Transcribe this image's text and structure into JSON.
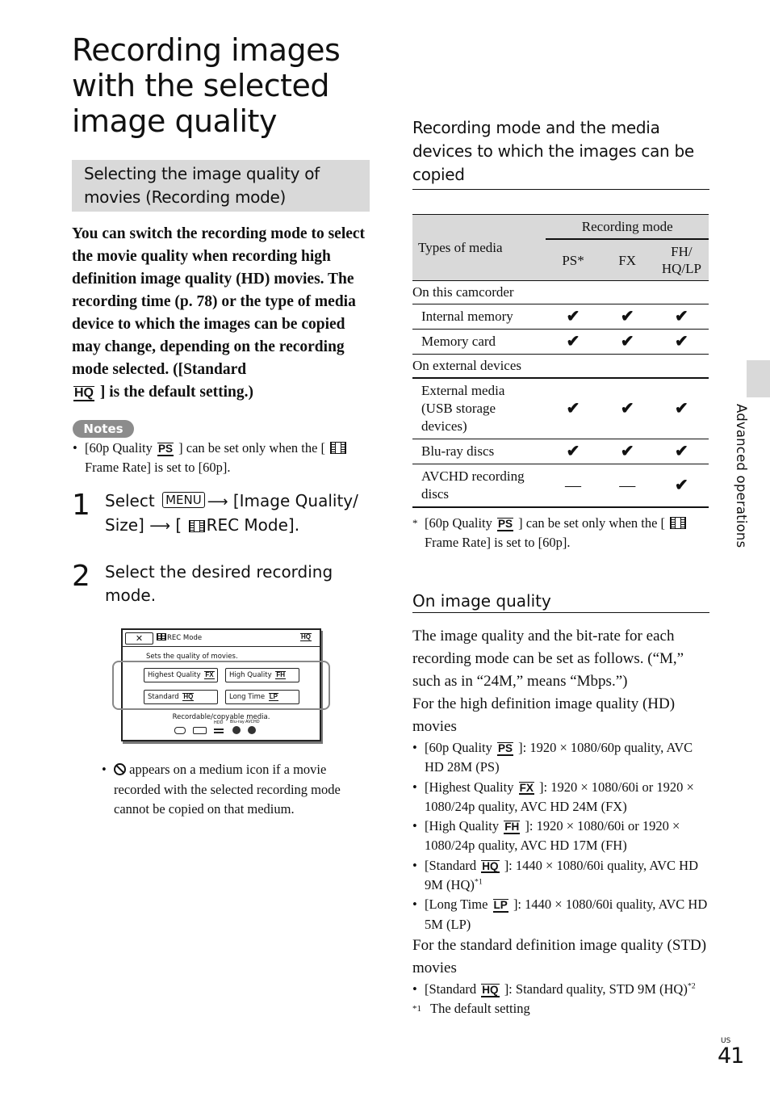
{
  "page": {
    "title": "Recording images with the selected image quality",
    "section_heading": "Selecting the image quality of movies (Recording mode)",
    "intro": {
      "text_a": "You can switch the recording mode to select the movie quality when recording high definition image quality (HD) movies. The recording time (p. 78) or the type of media device to which the images can be copied may change, depending on the recording mode selected. ([Standard ",
      "badge": "HQ",
      "text_b": " ] is the default setting.)"
    },
    "notes": {
      "badge_label": "Notes",
      "items": [
        {
          "pre": "[60p Quality ",
          "badge": "PS",
          "mid": " ] can be set only when the [ ",
          "post": "Frame Rate] is set to [60p]."
        }
      ]
    },
    "steps": [
      {
        "number": "1",
        "pre": "Select ",
        "menu_key": "MENU",
        "arrow": "⟶",
        "mid": " [Image Quality/ Size] ",
        "arrow2": "⟶",
        "bracket": " [ ",
        "post": "REC Mode]."
      },
      {
        "number": "2",
        "text": "Select the desired recording mode."
      }
    ],
    "screen": {
      "close_label": "✕",
      "title": "REC Mode",
      "current_mode": "HQ",
      "description": "Sets the quality of movies.",
      "options": [
        {
          "label": "Highest Quality ",
          "badge": "FX"
        },
        {
          "label": "High Quality ",
          "badge": "FH"
        },
        {
          "label": "Standard ",
          "badge": "HQ"
        },
        {
          "label": "Long Time ",
          "badge": "LP"
        }
      ],
      "media_label": "Recordable/copyable media.",
      "media_icons": [
        "internal-memory",
        "memory-card",
        "HDD",
        "Blu-ray",
        "AVCHD"
      ]
    },
    "prohibit_note": " appears on a medium icon if a movie recorded with the selected recording mode cannot be copied on that medium."
  },
  "right": {
    "heading": "Recording mode and the media devices to which the images can be copied",
    "table": {
      "types_header": "Types of media",
      "mode_header": "Recording mode",
      "columns": [
        "PS*",
        "FX",
        "FH/ HQ/LP"
      ],
      "groups": [
        {
          "label": "On this camcorder",
          "rows": [
            {
              "name": "Internal memory",
              "values": [
                "✔",
                "✔",
                "✔"
              ]
            },
            {
              "name": "Memory card",
              "values": [
                "✔",
                "✔",
                "✔"
              ]
            }
          ]
        },
        {
          "label": "On external devices",
          "rows": [
            {
              "name": "External media (USB storage devices)",
              "values": [
                "✔",
                "✔",
                "✔"
              ]
            },
            {
              "name": "Blu-ray discs",
              "values": [
                "✔",
                "✔",
                "✔"
              ]
            },
            {
              "name": "AVCHD recording discs",
              "values": [
                "—",
                "—",
                "✔"
              ]
            }
          ]
        }
      ]
    },
    "footnote_ps": {
      "mark": "*",
      "pre": "[60p Quality ",
      "badge": "PS",
      "mid": " ] can be set only when the [ ",
      "post": "Frame Rate] is set to [60p]."
    },
    "image_quality": {
      "heading": "On image quality",
      "para1": "The image quality and the bit-rate for each recording mode can be set as follows. (“M,” such as in “24M,” means “Mbps.”)",
      "hd_intro": "For the high definition image quality (HD) movies",
      "hd_items": [
        {
          "pre": "[60p Quality ",
          "badge": "PS",
          "post": " ]:  1920 × 1080/60p quality, AVC HD 28M (PS)",
          "sup": ""
        },
        {
          "pre": "[Highest Quality ",
          "badge": "FX",
          "post": " ]:  1920 × 1080/60i or 1920 × 1080/24p quality, AVC HD 24M (FX)",
          "sup": ""
        },
        {
          "pre": "[High Quality ",
          "badge": "FH",
          "post": " ]:  1920 × 1080/60i or 1920 × 1080/24p quality, AVC HD 17M (FH)",
          "sup": ""
        },
        {
          "pre": "[Standard ",
          "badge": "HQ",
          "post": " ]:  1440 × 1080/60i quality, AVC HD 9M (HQ)",
          "sup": "*1"
        },
        {
          "pre": "[Long Time ",
          "badge": "LP",
          "post": " ]:  1440 × 1080/60i quality, AVC HD 5M (LP)",
          "sup": ""
        }
      ],
      "std_intro": "For the standard definition image quality (STD) movies",
      "std_items": [
        {
          "pre": "[Standard ",
          "badge": "HQ",
          "post": " ]:  Standard quality, STD 9M (HQ)",
          "sup": "*2"
        }
      ],
      "footnote_mark": "*1",
      "footnote_text": "The default setting"
    }
  },
  "side": {
    "section_label": "Advanced operations"
  },
  "footer": {
    "region": "US",
    "page_number": "41"
  }
}
